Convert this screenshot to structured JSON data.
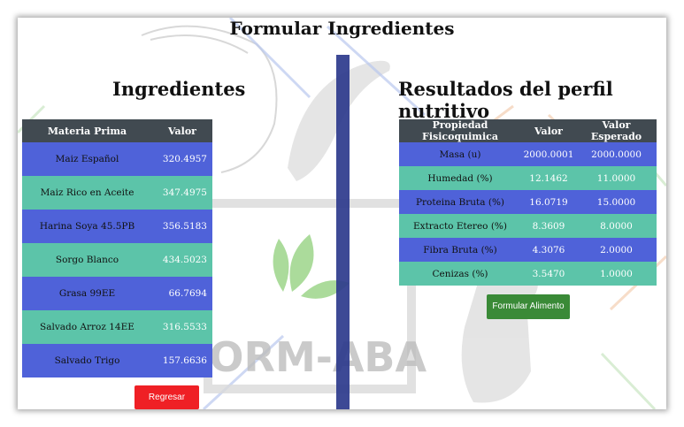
{
  "page": {
    "title": "Formular Ingredientes"
  },
  "ingredients": {
    "heading": "Ingredientes",
    "columns": [
      "Materia Prima",
      "Valor"
    ],
    "rows": [
      {
        "name": "Maiz Español",
        "value": "320.4957"
      },
      {
        "name": "Maiz Rico en Aceite",
        "value": "347.4975"
      },
      {
        "name": "Harina Soya 45.5PB",
        "value": "356.5183"
      },
      {
        "name": "Sorgo Blanco",
        "value": "434.5023"
      },
      {
        "name": "Grasa 99EE",
        "value": "66.7694"
      },
      {
        "name": "Salvado Arroz 14EE",
        "value": "316.5533"
      },
      {
        "name": "Salvado Trigo",
        "value": "157.6636"
      }
    ],
    "back_button": "Regresar"
  },
  "results": {
    "heading": "Resultados del perfil nutritivo",
    "columns": [
      "Propiedad Fisicoquimica",
      "Valor",
      "Valor Esperado"
    ],
    "rows": [
      {
        "prop": "Masa (u)",
        "value": "2000.0001",
        "expected": "2000.0000"
      },
      {
        "prop": "Humedad (%)",
        "value": "12.1462",
        "expected": "11.0000"
      },
      {
        "prop": "Proteina Bruta (%)",
        "value": "16.0719",
        "expected": "15.0000"
      },
      {
        "prop": "Extracto Etereo (%)",
        "value": "8.3609",
        "expected": "8.0000"
      },
      {
        "prop": "Fibra Bruta (%)",
        "value": "4.3076",
        "expected": "2.0000"
      },
      {
        "prop": "Cenizas (%)",
        "value": "3.5470",
        "expected": "1.0000"
      }
    ],
    "formulate_button": "Formular Alimento"
  },
  "watermark": {
    "text": "FORM-ABA"
  },
  "colors": {
    "row_blue": "#4f62d9",
    "row_teal": "#5cc4a9",
    "header": "#414a51",
    "divider": "#2d3a8c",
    "back_button": "#ef2025",
    "formulate_button": "#3a8a37"
  }
}
